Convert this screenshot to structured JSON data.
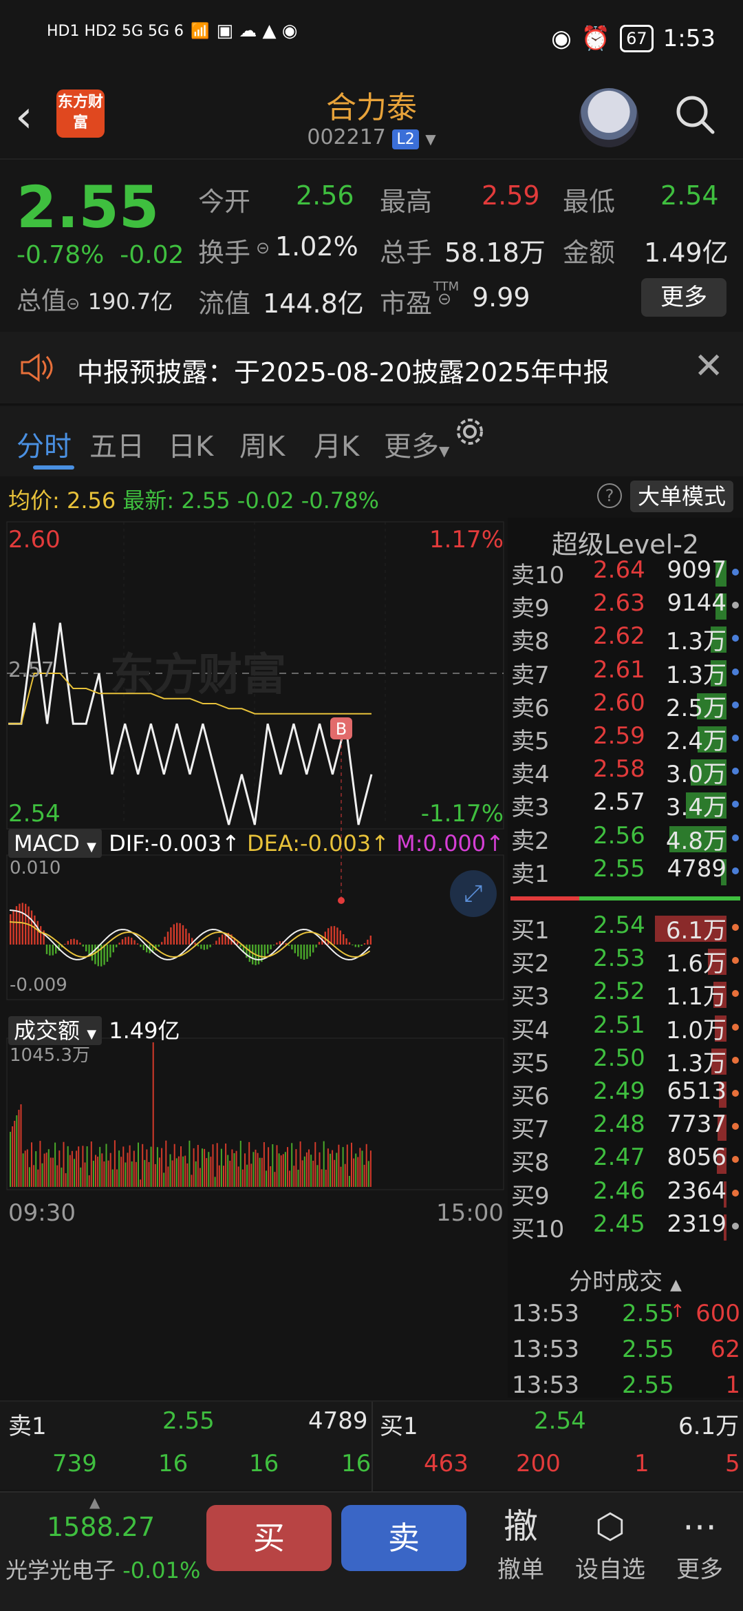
{
  "status_bar": {
    "signal_left": "HD1 HD2 5G 5G 6",
    "battery": "67",
    "time": "1:53"
  },
  "header": {
    "logo_text": "东方财富",
    "title": "合力泰",
    "code": "002217",
    "level_badge": "L2"
  },
  "quote": {
    "price": "2.55",
    "change_pct": "-0.78%",
    "change": "-0.02",
    "market_value_label": "总值",
    "market_value": "190.7亿",
    "fields": [
      {
        "label": "今开",
        "value": "2.56",
        "color": "green"
      },
      {
        "label": "最高",
        "value": "2.59",
        "color": "red"
      },
      {
        "label": "最低",
        "value": "2.54",
        "color": "green"
      },
      {
        "label": "换手",
        "value": "1.02%",
        "color": "white"
      },
      {
        "label": "总手",
        "value": "58.18万",
        "color": "white"
      },
      {
        "label": "金额",
        "value": "1.49亿",
        "color": "white"
      },
      {
        "label": "流值",
        "value": "144.8亿",
        "color": "white"
      },
      {
        "label": "市盈",
        "value": "9.99",
        "color": "white"
      }
    ],
    "pe_superscript": "TTM",
    "more_button": "更多"
  },
  "notice": {
    "text": "中报预披露：于2025-08-20披露2025年中报"
  },
  "tabs": [
    "分时",
    "五日",
    "日K",
    "周K",
    "月K",
    "更多"
  ],
  "info_line": {
    "avg_label": "均价:",
    "avg_value": "2.56",
    "latest_label": "最新:",
    "latest_value": "2.55",
    "change": "-0.02",
    "change_pct": "-0.78%",
    "help": "?",
    "mode_button": "大单模式"
  },
  "chart": {
    "price_high": "2.60",
    "price_high_pct": "1.17%",
    "price_mid": "2.57",
    "price_low": "2.54",
    "price_low_pct": "-1.17%",
    "watermark": "东方财富",
    "buy_marker": "B",
    "macd_label": "MACD",
    "dif": "DIF:-0.003",
    "dea": "DEA:-0.003",
    "m": "M:0.000",
    "macd_top": "0.010",
    "macd_bottom": "-0.009",
    "volume_label": "成交额",
    "volume_value": "1.49亿",
    "volume_max": "1045.3万",
    "time_start": "09:30",
    "time_end": "15:00"
  },
  "chart_data": {
    "type": "line",
    "series": [
      {
        "values": [
          2.56,
          2.56,
          2.58,
          2.56,
          2.58,
          2.56,
          2.56,
          2.57,
          2.55,
          2.56,
          2.55,
          2.56,
          2.55,
          2.56,
          2.55,
          2.56,
          2.55,
          2.54,
          2.55,
          2.54,
          2.56,
          2.55,
          2.56,
          2.55,
          2.56,
          2.55,
          2.56,
          2.54,
          2.55
        ]
      },
      {
        "values": [
          2.56,
          2.56,
          2.57,
          2.57,
          2.57,
          2.567,
          2.567,
          2.566,
          2.566,
          2.566,
          2.566,
          2.566,
          2.565,
          2.565,
          2.565,
          2.564,
          2.564,
          2.563,
          2.563,
          2.562,
          2.562,
          2.562,
          2.562,
          2.562,
          2.562,
          2.562,
          2.562,
          2.562,
          2.562
        ]
      }
    ],
    "ylim": [
      2.54,
      2.6
    ],
    "xlabel": "",
    "ylabel": ""
  },
  "order_book": {
    "title": "超级Level-2",
    "asks": [
      {
        "label": "卖10",
        "price": "2.64",
        "vol": "9097",
        "pc": "red"
      },
      {
        "label": "卖9",
        "price": "2.63",
        "vol": "9144",
        "pc": "red"
      },
      {
        "label": "卖8",
        "price": "2.62",
        "vol": "1.3万",
        "pc": "red"
      },
      {
        "label": "卖7",
        "price": "2.61",
        "vol": "1.3万",
        "pc": "red"
      },
      {
        "label": "卖6",
        "price": "2.60",
        "vol": "2.5万",
        "pc": "red"
      },
      {
        "label": "卖5",
        "price": "2.59",
        "vol": "2.4万",
        "pc": "red"
      },
      {
        "label": "卖4",
        "price": "2.58",
        "vol": "3.0万",
        "pc": "red"
      },
      {
        "label": "卖3",
        "price": "2.57",
        "vol": "3.4万",
        "pc": "white"
      },
      {
        "label": "卖2",
        "price": "2.56",
        "vol": "4.8万",
        "pc": "green"
      },
      {
        "label": "卖1",
        "price": "2.55",
        "vol": "4789",
        "pc": "green"
      }
    ],
    "bids": [
      {
        "label": "买1",
        "price": "2.54",
        "vol": "6.1万",
        "pc": "green"
      },
      {
        "label": "买2",
        "price": "2.53",
        "vol": "1.6万",
        "pc": "green"
      },
      {
        "label": "买3",
        "price": "2.52",
        "vol": "1.1万",
        "pc": "green"
      },
      {
        "label": "买4",
        "price": "2.51",
        "vol": "1.0万",
        "pc": "green"
      },
      {
        "label": "买5",
        "price": "2.50",
        "vol": "1.3万",
        "pc": "green"
      },
      {
        "label": "买6",
        "price": "2.49",
        "vol": "6513",
        "pc": "green"
      },
      {
        "label": "买7",
        "price": "2.48",
        "vol": "7737",
        "pc": "green"
      },
      {
        "label": "买8",
        "price": "2.47",
        "vol": "8056",
        "pc": "green"
      },
      {
        "label": "买9",
        "price": "2.46",
        "vol": "2364",
        "pc": "green"
      },
      {
        "label": "买10",
        "price": "2.45",
        "vol": "2319",
        "pc": "green"
      }
    ],
    "tick_title": "分时成交",
    "ticks": [
      {
        "time": "13:53",
        "price": "2.55",
        "arrow": "↑",
        "vol": "600",
        "vc": "red"
      },
      {
        "time": "13:53",
        "price": "2.55",
        "arrow": "",
        "vol": "62",
        "vc": "red"
      },
      {
        "time": "13:53",
        "price": "2.55",
        "arrow": "",
        "vol": "1",
        "vc": "red"
      }
    ]
  },
  "bottom_order": {
    "sell1_label": "卖1",
    "sell1_price": "2.55",
    "sell1_vol": "4789",
    "sell_queue": [
      "739",
      "16",
      "16",
      "16"
    ],
    "buy1_label": "买1",
    "buy1_price": "2.54",
    "buy1_vol": "6.1万",
    "buy_queue": [
      "463",
      "200",
      "1",
      "5"
    ]
  },
  "trade_bar": {
    "index_value": "1588.27",
    "index_name": "光学光电子",
    "index_change": "-0.01%",
    "buy": "买",
    "sell": "卖",
    "cancel_icon": "撤",
    "cancel": "撤单",
    "watch": "设自选",
    "more": "更多"
  }
}
